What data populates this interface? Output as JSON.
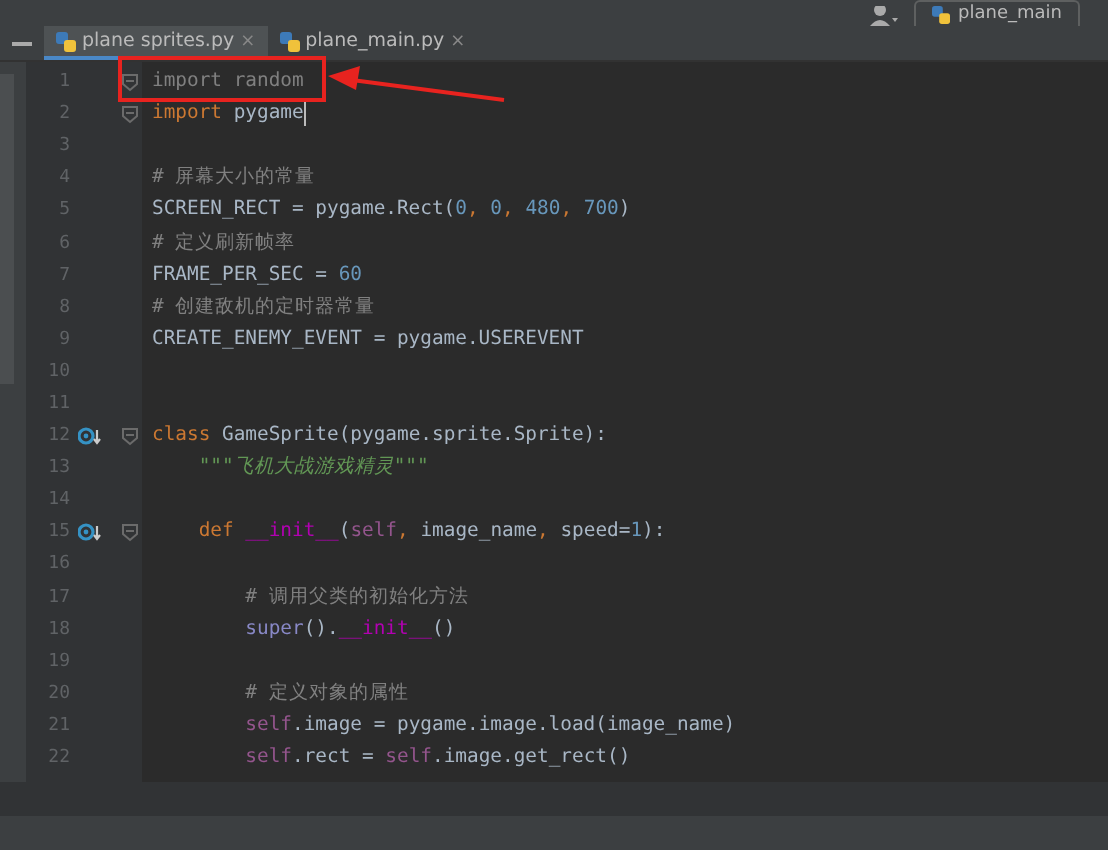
{
  "toolbar": {
    "run_config": "plane_main"
  },
  "tabs": [
    {
      "label": "plane sprites.py",
      "close": "×",
      "selected": true
    },
    {
      "label": "plane_main.py",
      "close": "×",
      "selected": false
    }
  ],
  "editor": {
    "lines": [
      {
        "number": "1",
        "fold": true,
        "override": false,
        "caret": false,
        "tokens": [
          {
            "kind": "unused",
            "text": "import random"
          }
        ]
      },
      {
        "number": "2",
        "fold": true,
        "override": false,
        "caret": true,
        "tokens": [
          {
            "kind": "kw",
            "text": "import"
          },
          {
            "kind": "plain",
            "text": " pygame"
          }
        ]
      },
      {
        "number": "3",
        "fold": false,
        "override": false,
        "caret": false
      },
      {
        "number": "4",
        "fold": false,
        "override": false,
        "caret": false,
        "tokens": [
          {
            "kind": "comment",
            "text": "# 屏幕大小的常量"
          }
        ]
      },
      {
        "number": "5",
        "fold": false,
        "override": false,
        "caret": false,
        "tokens": [
          {
            "kind": "plain",
            "text": "SCREEN_RECT = pygame.Rect("
          },
          {
            "kind": "number",
            "text": "0"
          },
          {
            "kind": "punct",
            "text": ", "
          },
          {
            "kind": "number",
            "text": "0"
          },
          {
            "kind": "punct",
            "text": ", "
          },
          {
            "kind": "number",
            "text": "480"
          },
          {
            "kind": "punct",
            "text": ", "
          },
          {
            "kind": "number",
            "text": "700"
          },
          {
            "kind": "plain",
            "text": ")"
          }
        ]
      },
      {
        "number": "6",
        "fold": false,
        "override": false,
        "caret": false,
        "tokens": [
          {
            "kind": "comment",
            "text": "# 定义刷新帧率"
          }
        ]
      },
      {
        "number": "7",
        "fold": false,
        "override": false,
        "caret": false,
        "tokens": [
          {
            "kind": "plain",
            "text": "FRAME_PER_SEC = "
          },
          {
            "kind": "number",
            "text": "60"
          }
        ]
      },
      {
        "number": "8",
        "fold": false,
        "override": false,
        "caret": false,
        "tokens": [
          {
            "kind": "comment",
            "text": "# 创建敌机的定时器常量"
          }
        ]
      },
      {
        "number": "9",
        "fold": false,
        "override": false,
        "caret": false,
        "tokens": [
          {
            "kind": "plain",
            "text": "CREATE_ENEMY_EVENT = pygame.USEREVENT"
          }
        ]
      },
      {
        "number": "10",
        "fold": false,
        "override": false,
        "caret": false
      },
      {
        "number": "11",
        "fold": false,
        "override": false,
        "caret": false
      },
      {
        "number": "12",
        "fold": true,
        "override": true,
        "caret": false,
        "tokens": [
          {
            "kind": "kw",
            "text": "class"
          },
          {
            "kind": "plain",
            "text": " GameSprite(pygame.sprite.Sprite):"
          }
        ]
      },
      {
        "number": "13",
        "fold": false,
        "override": false,
        "caret": false,
        "tokens": [
          {
            "kind": "docstring",
            "text": "    \"\"\"飞机大战游戏精灵\"\"\""
          }
        ]
      },
      {
        "number": "14",
        "fold": false,
        "override": false,
        "caret": false
      },
      {
        "number": "15",
        "fold": true,
        "override": true,
        "caret": false,
        "tokens": [
          {
            "kind": "kw",
            "text": "    def "
          },
          {
            "kind": "magic",
            "text": "__init__"
          },
          {
            "kind": "plain",
            "text": "("
          },
          {
            "kind": "self",
            "text": "self"
          },
          {
            "kind": "punct",
            "text": ", "
          },
          {
            "kind": "plain",
            "text": "image_name"
          },
          {
            "kind": "punct",
            "text": ", "
          },
          {
            "kind": "plain",
            "text": "speed="
          },
          {
            "kind": "number",
            "text": "1"
          },
          {
            "kind": "plain",
            "text": "):"
          }
        ]
      },
      {
        "number": "16",
        "fold": false,
        "override": false,
        "caret": false
      },
      {
        "number": "17",
        "fold": false,
        "override": false,
        "caret": false,
        "tokens": [
          {
            "kind": "comment",
            "text": "        # 调用父类的初始化方法"
          }
        ]
      },
      {
        "number": "18",
        "fold": false,
        "override": false,
        "caret": false,
        "tokens": [
          {
            "kind": "builtin",
            "text": "        super"
          },
          {
            "kind": "plain",
            "text": "()."
          },
          {
            "kind": "magic",
            "text": "__init__"
          },
          {
            "kind": "plain",
            "text": "()"
          }
        ]
      },
      {
        "number": "19",
        "fold": false,
        "override": false,
        "caret": false
      },
      {
        "number": "20",
        "fold": false,
        "override": false,
        "caret": false,
        "tokens": [
          {
            "kind": "comment",
            "text": "        # 定义对象的属性"
          }
        ]
      },
      {
        "number": "21",
        "fold": false,
        "override": false,
        "caret": false,
        "tokens": [
          {
            "kind": "self",
            "text": "        self"
          },
          {
            "kind": "plain",
            "text": ".image = pygame.image.load(image_name)"
          }
        ]
      },
      {
        "number": "22",
        "fold": false,
        "override": false,
        "caret": false,
        "tokens": [
          {
            "kind": "self",
            "text": "        self"
          },
          {
            "kind": "plain",
            "text": ".rect = "
          },
          {
            "kind": "self",
            "text": "self"
          },
          {
            "kind": "plain",
            "text": ".image.get_rect()"
          }
        ]
      }
    ]
  }
}
